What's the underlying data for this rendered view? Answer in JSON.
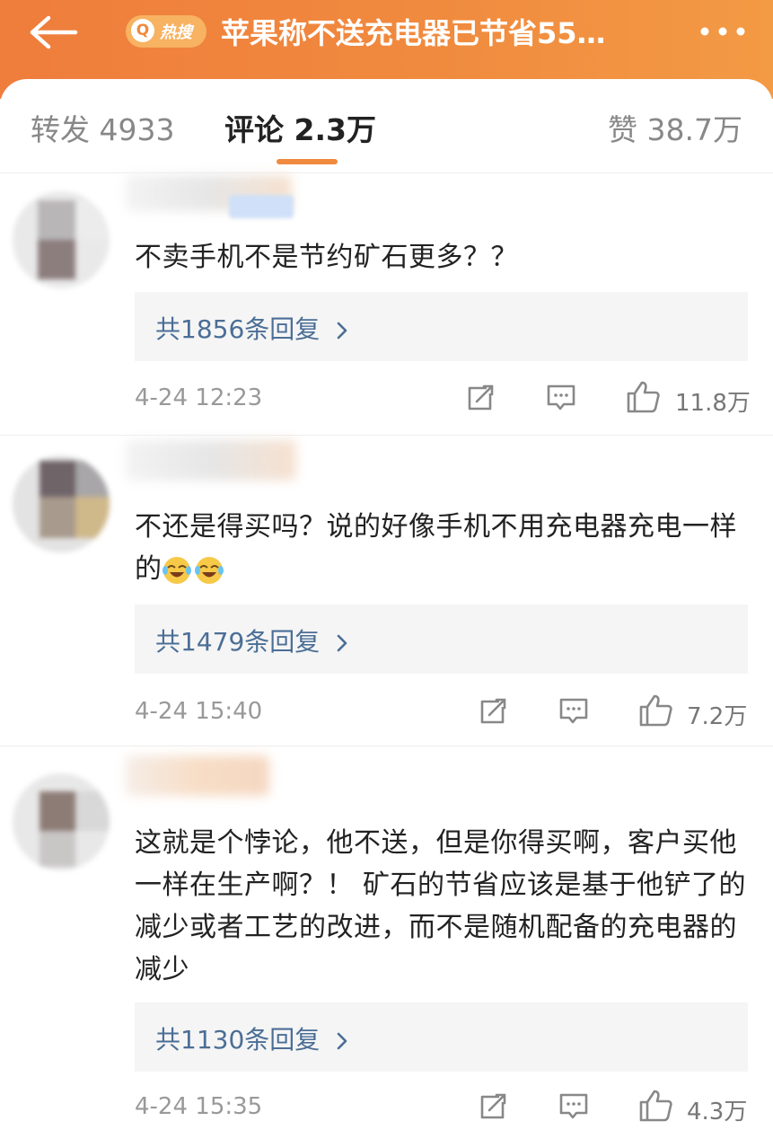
{
  "header": {
    "hot_badge_label": "热搜",
    "title": "苹果称不送充电器已节省55…"
  },
  "tabs": {
    "repost": "转发 4933",
    "comment": "评论 2.3万",
    "like": "赞 38.7万"
  },
  "comments": [
    {
      "text": "不卖手机不是节约矿石更多？？",
      "replies": "共1856条回复",
      "time": "4-24 12:23",
      "likes": "11.8万"
    },
    {
      "text": "不还是得买吗？说的好像手机不用充电器充电一样的",
      "replies": "共1479条回复",
      "time": "4-24 15:40",
      "likes": "7.2万"
    },
    {
      "text": "这就是个悖论，他不送，但是你得买啊，客户买他一样在生产啊？！ 矿石的节省应该是基于他铲了的减少或者工艺的改进，而不是随机配备的充电器的减少",
      "replies": "共1130条回复",
      "time": "4-24 15:35",
      "likes": "4.3万"
    }
  ],
  "icons": {
    "back": "arrow-left-icon",
    "more": "more-dots-icon",
    "share": "share-icon",
    "reply": "comment-icon",
    "like": "thumbs-up-icon",
    "emoji": "laughing-tears-emoji"
  },
  "colors": {
    "header_orange": "#f08a3e",
    "reply_link": "#4b6e96",
    "tab_underline": "#f08a3e"
  }
}
